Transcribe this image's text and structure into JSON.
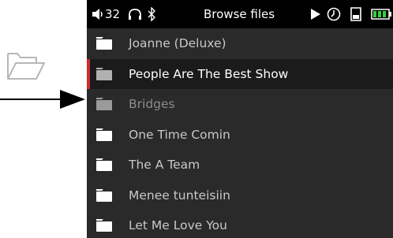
{
  "status_bar": {
    "volume": "32",
    "title": "Browse files",
    "icons": [
      "speaker-icon",
      "headphones-icon",
      "bluetooth-icon",
      "play-icon",
      "clock-icon",
      "sd-card-icon",
      "battery-icon"
    ]
  },
  "colors": {
    "selection_bar": "#d22c2c",
    "battery": "#35d13a",
    "background": "#2a2a2a"
  },
  "folders": [
    {
      "label": "Joanne (Deluxe)",
      "state": "normal"
    },
    {
      "label": "People Are The Best Show",
      "state": "selected"
    },
    {
      "label": "Bridges",
      "state": "dimmed"
    },
    {
      "label": "One Time Comin",
      "state": "normal"
    },
    {
      "label": "The A Team",
      "state": "normal"
    },
    {
      "label": "Menee tunteisiin",
      "state": "normal"
    },
    {
      "label": "Let Me Love You",
      "state": "normal"
    }
  ]
}
